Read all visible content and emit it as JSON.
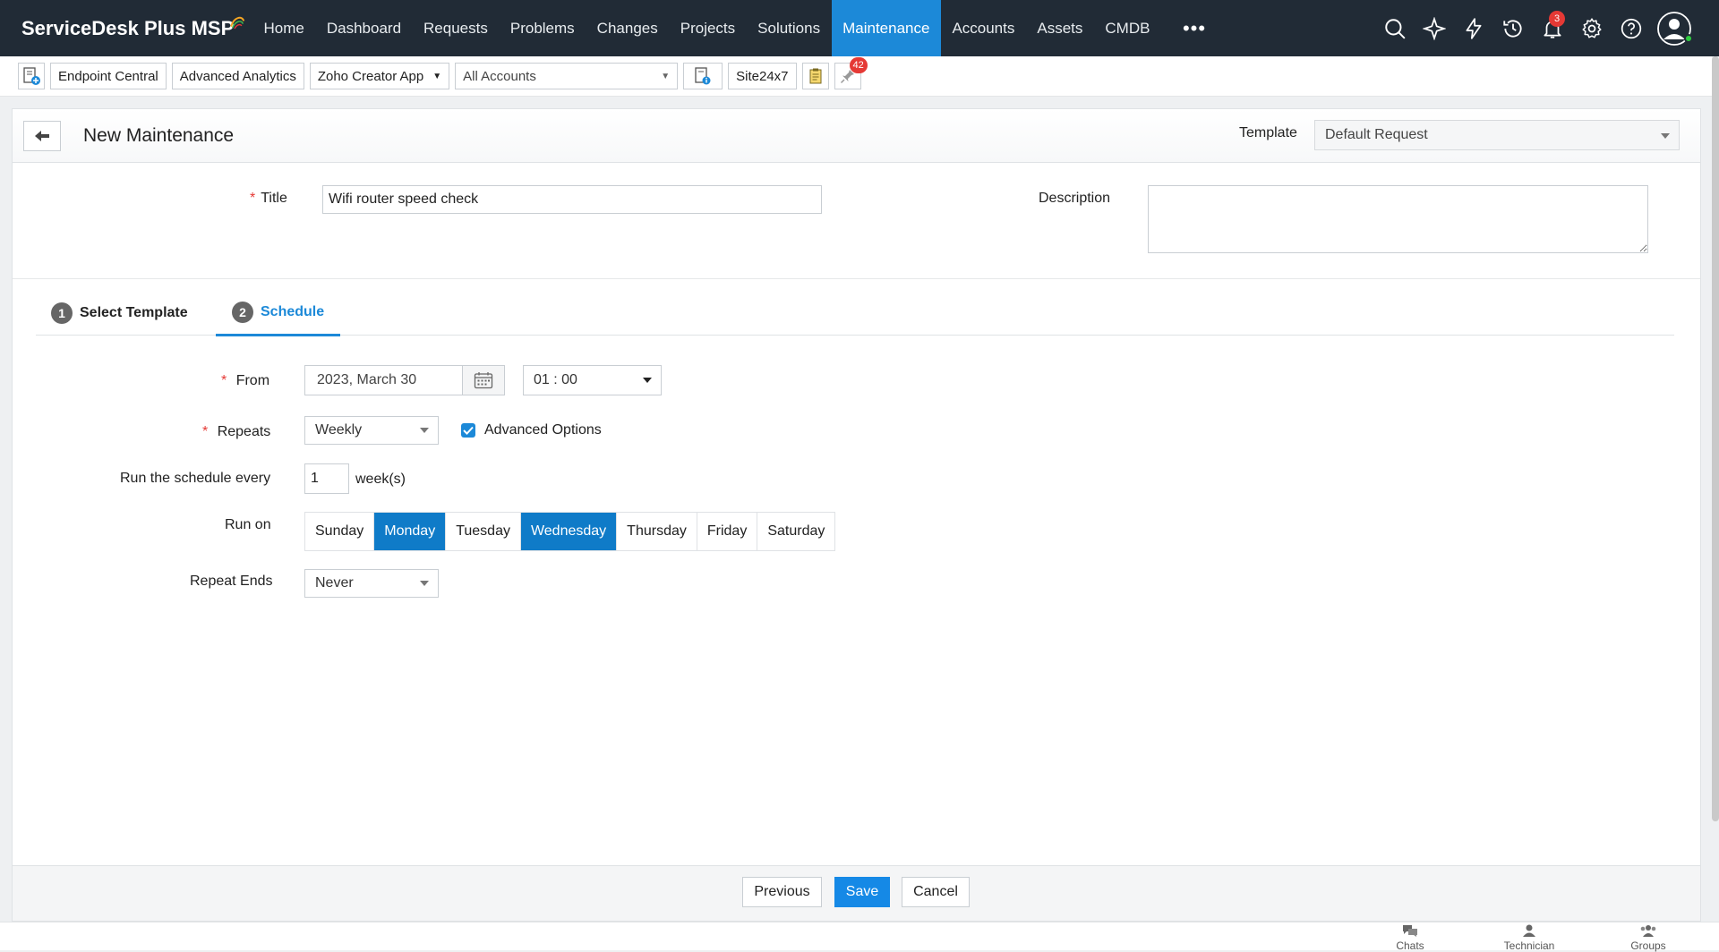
{
  "app": {
    "name": "ServiceDesk Plus MSP"
  },
  "nav": {
    "items": [
      "Home",
      "Dashboard",
      "Requests",
      "Problems",
      "Changes",
      "Projects",
      "Solutions",
      "Maintenance",
      "Accounts",
      "Assets",
      "CMDB"
    ],
    "active": "Maintenance",
    "more": "•••",
    "notifications_count": "3"
  },
  "toolbar": {
    "endpoint_central": "Endpoint Central",
    "advanced_analytics": "Advanced Analytics",
    "zoho_creator": "Zoho Creator App",
    "accounts_select": "All Accounts",
    "site24x7": "Site24x7",
    "pin_count": "42"
  },
  "page": {
    "title": "New Maintenance",
    "template_label": "Template",
    "template_value": "Default Request"
  },
  "form": {
    "title_label": "Title",
    "title_value": "Wifi router speed check",
    "description_label": "Description",
    "description_value": ""
  },
  "tabs": [
    {
      "num": "1",
      "label": "Select Template",
      "active": false
    },
    {
      "num": "2",
      "label": "Schedule",
      "active": true
    }
  ],
  "schedule": {
    "from_label": "From",
    "from_date": "2023, March 30",
    "from_time": "01 : 00",
    "repeats_label": "Repeats",
    "repeats_value": "Weekly",
    "advanced_options_label": "Advanced Options",
    "advanced_options_checked": true,
    "run_every_label": "Run the schedule every",
    "run_every_value": "1",
    "run_every_unit": "week(s)",
    "run_on_label": "Run on",
    "days": [
      {
        "label": "Sunday",
        "selected": false
      },
      {
        "label": "Monday",
        "selected": true
      },
      {
        "label": "Tuesday",
        "selected": false
      },
      {
        "label": "Wednesday",
        "selected": true
      },
      {
        "label": "Thursday",
        "selected": false
      },
      {
        "label": "Friday",
        "selected": false
      },
      {
        "label": "Saturday",
        "selected": false
      }
    ],
    "repeat_ends_label": "Repeat Ends",
    "repeat_ends_value": "Never"
  },
  "footer": {
    "previous": "Previous",
    "save": "Save",
    "cancel": "Cancel"
  },
  "bottom_bar": {
    "chats": "Chats",
    "technician": "Technician",
    "groups": "Groups"
  },
  "colors": {
    "nav_bg": "#212b36",
    "accent": "#1c89d8",
    "selected_day": "#0f7bc8",
    "required": "#e53935"
  }
}
